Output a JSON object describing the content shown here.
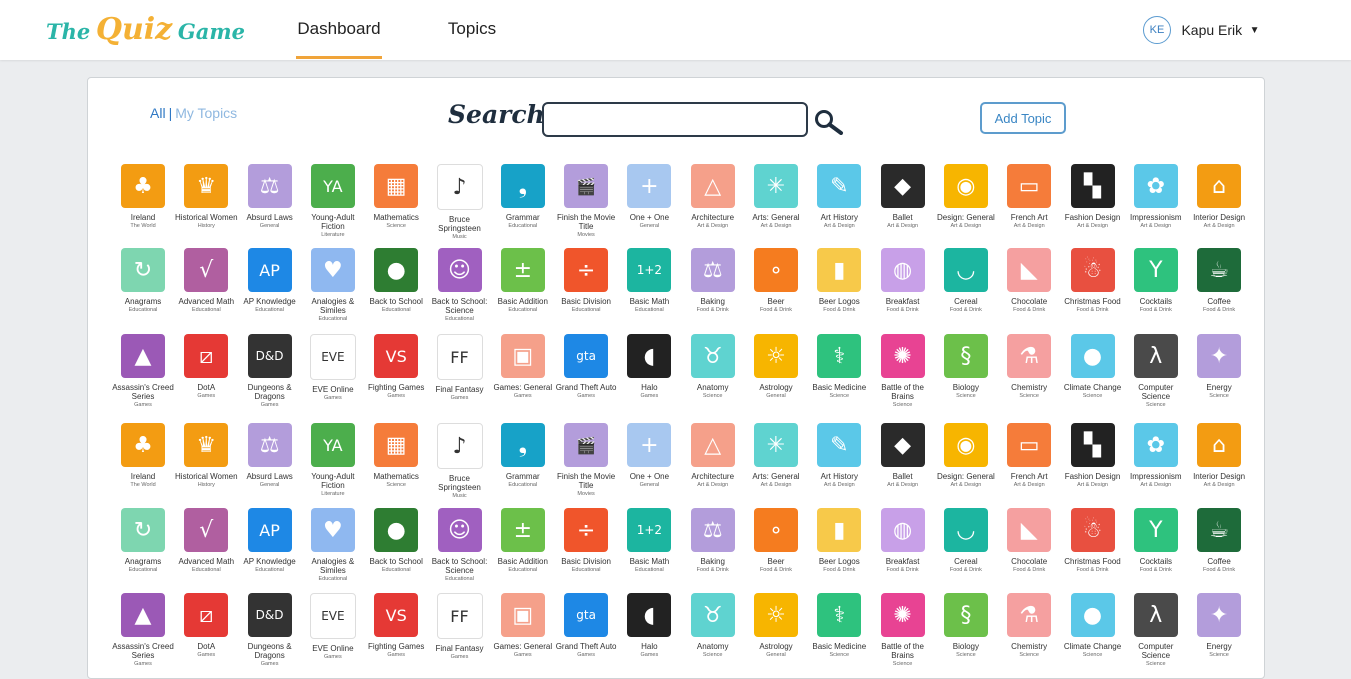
{
  "header": {
    "logo": {
      "w1": "The",
      "w2": "Quiz",
      "w3": "Game"
    },
    "tabs": [
      {
        "label": "Dashboard"
      },
      {
        "label": "Topics"
      }
    ],
    "user": {
      "initials": "KE",
      "name": "Kapu Erik"
    }
  },
  "panel": {
    "filter": {
      "all": "All",
      "separator": "|",
      "mine": "My Topics"
    },
    "search": {
      "label": "Search",
      "placeholder": "",
      "value": ""
    },
    "add_topic": "Add Topic"
  },
  "rows": [
    [
      {
        "name": "Ireland",
        "category": "The World",
        "bg": "#f39c12",
        "glyph": "♣"
      },
      {
        "name": "Historical Women",
        "category": "History",
        "bg": "#f39c12",
        "glyph": "♛"
      },
      {
        "name": "Absurd Laws",
        "category": "General",
        "bg": "#b39ddb",
        "glyph": "⚖"
      },
      {
        "name": "Young-Adult Fiction",
        "category": "Literature",
        "bg": "#4cae4c",
        "glyph": "YA"
      },
      {
        "name": "Mathematics",
        "category": "Science",
        "bg": "#f57c3a",
        "glyph": "▦"
      },
      {
        "name": "Bruce Springsteen",
        "category": "Music",
        "bg": "#ffffff",
        "glyph": "♪"
      },
      {
        "name": "Grammar",
        "category": "Educational",
        "bg": "#17a2c8",
        "glyph": "❟"
      },
      {
        "name": "Finish the Movie Title",
        "category": "Movies",
        "bg": "#b39ddb",
        "glyph": "🎬"
      },
      {
        "name": "One + One",
        "category": "General",
        "bg": "#a8c8f0",
        "glyph": "+"
      },
      {
        "name": "Architecture",
        "category": "Art & Design",
        "bg": "#f5a08a",
        "glyph": "△"
      },
      {
        "name": "Arts: General",
        "category": "Art & Design",
        "bg": "#5fd3d0",
        "glyph": "✳"
      },
      {
        "name": "Art History",
        "category": "Art & Design",
        "bg": "#5bc8e8",
        "glyph": "✎"
      },
      {
        "name": "Ballet",
        "category": "Art & Design",
        "bg": "#2a2a2a",
        "glyph": "◆"
      },
      {
        "name": "Design: General",
        "category": "Art & Design",
        "bg": "#f7b500",
        "glyph": "◉"
      },
      {
        "name": "French Art",
        "category": "Art & Design",
        "bg": "#f57c3a",
        "glyph": "▭"
      },
      {
        "name": "Fashion Design",
        "category": "Art & Design",
        "bg": "#222222",
        "glyph": "▚"
      },
      {
        "name": "Impressionism",
        "category": "Art & Design",
        "bg": "#5bc8e8",
        "glyph": "✿"
      },
      {
        "name": "Interior Design",
        "category": "Art & Design",
        "bg": "#f39c12",
        "glyph": "⌂"
      }
    ],
    [
      {
        "name": "Anagrams",
        "category": "Educational",
        "bg": "#7ed6b0",
        "glyph": "↻"
      },
      {
        "name": "Advanced Math",
        "category": "Educational",
        "bg": "#b05fa0",
        "glyph": "√"
      },
      {
        "name": "AP Knowledge",
        "category": "Educational",
        "bg": "#1e88e5",
        "glyph": "AP"
      },
      {
        "name": "Analogies & Similes",
        "category": "Educational",
        "bg": "#8fb8f0",
        "glyph": "♥"
      },
      {
        "name": "Back to School",
        "category": "Educational",
        "bg": "#2e7d32",
        "glyph": "●"
      },
      {
        "name": "Back to School: Science",
        "category": "Educational",
        "bg": "#a060c0",
        "glyph": "☺"
      },
      {
        "name": "Basic Addition",
        "category": "Educational",
        "bg": "#6cc04a",
        "glyph": "±"
      },
      {
        "name": "Basic Division",
        "category": "Educational",
        "bg": "#f0552b",
        "glyph": "÷"
      },
      {
        "name": "Basic Math",
        "category": "Educational",
        "bg": "#1cb5a0",
        "glyph": "1+2"
      },
      {
        "name": "Baking",
        "category": "Food & Drink",
        "bg": "#b39ddb",
        "glyph": "⚖"
      },
      {
        "name": "Beer",
        "category": "Food & Drink",
        "bg": "#f57c1f",
        "glyph": "∘"
      },
      {
        "name": "Beer Logos",
        "category": "Food & Drink",
        "bg": "#f7c94a",
        "glyph": "▮"
      },
      {
        "name": "Breakfast",
        "category": "Food & Drink",
        "bg": "#c8a0e8",
        "glyph": "◍"
      },
      {
        "name": "Cereal",
        "category": "Food & Drink",
        "bg": "#1cb5a0",
        "glyph": "◡"
      },
      {
        "name": "Chocolate",
        "category": "Food & Drink",
        "bg": "#f5a0a0",
        "glyph": "◣"
      },
      {
        "name": "Christmas Food",
        "category": "Food & Drink",
        "bg": "#e85040",
        "glyph": "☃"
      },
      {
        "name": "Cocktails",
        "category": "Food & Drink",
        "bg": "#2ec27e",
        "glyph": "Y"
      },
      {
        "name": "Coffee",
        "category": "Food & Drink",
        "bg": "#1e6b3a",
        "glyph": "☕"
      }
    ],
    [
      {
        "name": "Assassin's Creed Series",
        "category": "Games",
        "bg": "#9b59b6",
        "glyph": "▲"
      },
      {
        "name": "DotA",
        "category": "Games",
        "bg": "#e53935",
        "glyph": "⧄"
      },
      {
        "name": "Dungeons & Dragons",
        "category": "Games",
        "bg": "#333333",
        "glyph": "D&D"
      },
      {
        "name": "EVE Online",
        "category": "Games",
        "bg": "#ffffff",
        "glyph": "EVE"
      },
      {
        "name": "Fighting Games",
        "category": "Games",
        "bg": "#e53935",
        "glyph": "VS"
      },
      {
        "name": "Final Fantasy",
        "category": "Games",
        "bg": "#ffffff",
        "glyph": "FF"
      },
      {
        "name": "Games: General",
        "category": "Games",
        "bg": "#f5a08a",
        "glyph": "▣"
      },
      {
        "name": "Grand Theft Auto",
        "category": "Games",
        "bg": "#1e88e5",
        "glyph": "gta"
      },
      {
        "name": "Halo",
        "category": "Games",
        "bg": "#222222",
        "glyph": "◖"
      },
      {
        "name": "Anatomy",
        "category": "Science",
        "bg": "#5fd3d0",
        "glyph": "♉"
      },
      {
        "name": "Astrology",
        "category": "General",
        "bg": "#f7b500",
        "glyph": "☼"
      },
      {
        "name": "Basic Medicine",
        "category": "Science",
        "bg": "#2ec27e",
        "glyph": "⚕"
      },
      {
        "name": "Battle of the Brains",
        "category": "Science",
        "bg": "#e84393",
        "glyph": "✺"
      },
      {
        "name": "Biology",
        "category": "Science",
        "bg": "#6cc04a",
        "glyph": "§"
      },
      {
        "name": "Chemistry",
        "category": "Science",
        "bg": "#f5a0a0",
        "glyph": "⚗"
      },
      {
        "name": "Climate Change",
        "category": "Science",
        "bg": "#5bc8e8",
        "glyph": "●"
      },
      {
        "name": "Computer Science",
        "category": "Science",
        "bg": "#4a4a4a",
        "glyph": "λ"
      },
      {
        "name": "Energy",
        "category": "Science",
        "bg": "#b39ddb",
        "glyph": "✦"
      }
    ],
    [
      {
        "name": "Ireland",
        "category": "The World",
        "bg": "#f39c12",
        "glyph": "♣"
      },
      {
        "name": "Historical Women",
        "category": "History",
        "bg": "#f39c12",
        "glyph": "♛"
      },
      {
        "name": "Absurd Laws",
        "category": "General",
        "bg": "#b39ddb",
        "glyph": "⚖"
      },
      {
        "name": "Young-Adult Fiction",
        "category": "Literature",
        "bg": "#4cae4c",
        "glyph": "YA"
      },
      {
        "name": "Mathematics",
        "category": "Science",
        "bg": "#f57c3a",
        "glyph": "▦"
      },
      {
        "name": "Bruce Springsteen",
        "category": "Music",
        "bg": "#ffffff",
        "glyph": "♪"
      },
      {
        "name": "Grammar",
        "category": "Educational",
        "bg": "#17a2c8",
        "glyph": "❟"
      },
      {
        "name": "Finish the Movie Title",
        "category": "Movies",
        "bg": "#b39ddb",
        "glyph": "🎬"
      },
      {
        "name": "One + One",
        "category": "General",
        "bg": "#a8c8f0",
        "glyph": "+"
      },
      {
        "name": "Architecture",
        "category": "Art & Design",
        "bg": "#f5a08a",
        "glyph": "△"
      },
      {
        "name": "Arts: General",
        "category": "Art & Design",
        "bg": "#5fd3d0",
        "glyph": "✳"
      },
      {
        "name": "Art History",
        "category": "Art & Design",
        "bg": "#5bc8e8",
        "glyph": "✎"
      },
      {
        "name": "Ballet",
        "category": "Art & Design",
        "bg": "#2a2a2a",
        "glyph": "◆"
      },
      {
        "name": "Design: General",
        "category": "Art & Design",
        "bg": "#f7b500",
        "glyph": "◉"
      },
      {
        "name": "French Art",
        "category": "Art & Design",
        "bg": "#f57c3a",
        "glyph": "▭"
      },
      {
        "name": "Fashion Design",
        "category": "Art & Design",
        "bg": "#222222",
        "glyph": "▚"
      },
      {
        "name": "Impressionism",
        "category": "Art & Design",
        "bg": "#5bc8e8",
        "glyph": "✿"
      },
      {
        "name": "Interior Design",
        "category": "Art & Design",
        "bg": "#f39c12",
        "glyph": "⌂"
      }
    ],
    [
      {
        "name": "Anagrams",
        "category": "Educational",
        "bg": "#7ed6b0",
        "glyph": "↻"
      },
      {
        "name": "Advanced Math",
        "category": "Educational",
        "bg": "#b05fa0",
        "glyph": "√"
      },
      {
        "name": "AP Knowledge",
        "category": "Educational",
        "bg": "#1e88e5",
        "glyph": "AP"
      },
      {
        "name": "Analogies & Similes",
        "category": "Educational",
        "bg": "#8fb8f0",
        "glyph": "♥"
      },
      {
        "name": "Back to School",
        "category": "Educational",
        "bg": "#2e7d32",
        "glyph": "●"
      },
      {
        "name": "Back to School: Science",
        "category": "Educational",
        "bg": "#a060c0",
        "glyph": "☺"
      },
      {
        "name": "Basic Addition",
        "category": "Educational",
        "bg": "#6cc04a",
        "glyph": "±"
      },
      {
        "name": "Basic Division",
        "category": "Educational",
        "bg": "#f0552b",
        "glyph": "÷"
      },
      {
        "name": "Basic Math",
        "category": "Educational",
        "bg": "#1cb5a0",
        "glyph": "1+2"
      },
      {
        "name": "Baking",
        "category": "Food & Drink",
        "bg": "#b39ddb",
        "glyph": "⚖"
      },
      {
        "name": "Beer",
        "category": "Food & Drink",
        "bg": "#f57c1f",
        "glyph": "∘"
      },
      {
        "name": "Beer Logos",
        "category": "Food & Drink",
        "bg": "#f7c94a",
        "glyph": "▮"
      },
      {
        "name": "Breakfast",
        "category": "Food & Drink",
        "bg": "#c8a0e8",
        "glyph": "◍"
      },
      {
        "name": "Cereal",
        "category": "Food & Drink",
        "bg": "#1cb5a0",
        "glyph": "◡"
      },
      {
        "name": "Chocolate",
        "category": "Food & Drink",
        "bg": "#f5a0a0",
        "glyph": "◣"
      },
      {
        "name": "Christmas Food",
        "category": "Food & Drink",
        "bg": "#e85040",
        "glyph": "☃"
      },
      {
        "name": "Cocktails",
        "category": "Food & Drink",
        "bg": "#2ec27e",
        "glyph": "Y"
      },
      {
        "name": "Coffee",
        "category": "Food & Drink",
        "bg": "#1e6b3a",
        "glyph": "☕"
      }
    ],
    [
      {
        "name": "Assassin's Creed Series",
        "category": "Games",
        "bg": "#9b59b6",
        "glyph": "▲"
      },
      {
        "name": "DotA",
        "category": "Games",
        "bg": "#e53935",
        "glyph": "⧄"
      },
      {
        "name": "Dungeons & Dragons",
        "category": "Games",
        "bg": "#333333",
        "glyph": "D&D"
      },
      {
        "name": "EVE Online",
        "category": "Games",
        "bg": "#ffffff",
        "glyph": "EVE"
      },
      {
        "name": "Fighting Games",
        "category": "Games",
        "bg": "#e53935",
        "glyph": "VS"
      },
      {
        "name": "Final Fantasy",
        "category": "Games",
        "bg": "#ffffff",
        "glyph": "FF"
      },
      {
        "name": "Games: General",
        "category": "Games",
        "bg": "#f5a08a",
        "glyph": "▣"
      },
      {
        "name": "Grand Theft Auto",
        "category": "Games",
        "bg": "#1e88e5",
        "glyph": "gta"
      },
      {
        "name": "Halo",
        "category": "Games",
        "bg": "#222222",
        "glyph": "◖"
      },
      {
        "name": "Anatomy",
        "category": "Science",
        "bg": "#5fd3d0",
        "glyph": "♉"
      },
      {
        "name": "Astrology",
        "category": "General",
        "bg": "#f7b500",
        "glyph": "☼"
      },
      {
        "name": "Basic Medicine",
        "category": "Science",
        "bg": "#2ec27e",
        "glyph": "⚕"
      },
      {
        "name": "Battle of the Brains",
        "category": "Science",
        "bg": "#e84393",
        "glyph": "✺"
      },
      {
        "name": "Biology",
        "category": "Science",
        "bg": "#6cc04a",
        "glyph": "§"
      },
      {
        "name": "Chemistry",
        "category": "Science",
        "bg": "#f5a0a0",
        "glyph": "⚗"
      },
      {
        "name": "Climate Change",
        "category": "Science",
        "bg": "#5bc8e8",
        "glyph": "●"
      },
      {
        "name": "Computer Science",
        "category": "Science",
        "bg": "#4a4a4a",
        "glyph": "λ"
      },
      {
        "name": "Energy",
        "category": "Science",
        "bg": "#b39ddb",
        "glyph": "✦"
      }
    ]
  ]
}
